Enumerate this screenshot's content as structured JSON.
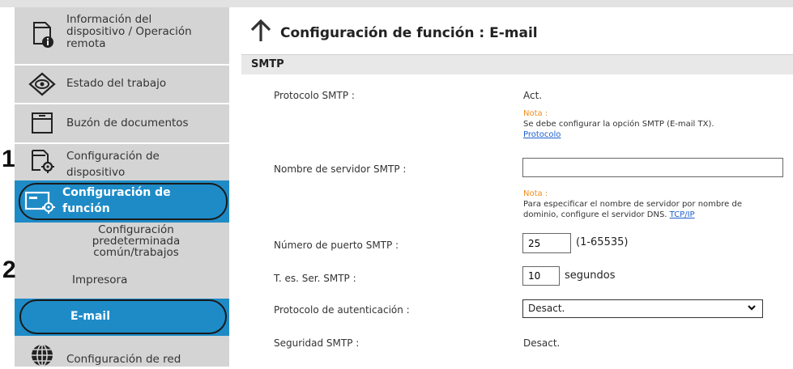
{
  "sidebar": {
    "items": [
      {
        "label": "Información del dispositivo / Operación remota",
        "icon": "device-info-icon"
      },
      {
        "label": "Estado del trabajo",
        "icon": "eye-icon"
      },
      {
        "label": "Buzón de documentos",
        "icon": "document-box-icon"
      },
      {
        "label": "Configuración de dispositivo",
        "icon": "device-settings-icon"
      },
      {
        "label": "Configuración de función",
        "icon": "function-settings-icon"
      },
      {
        "label": "Configuración predeterminada común/trabajos"
      },
      {
        "label": "Impresora"
      },
      {
        "label": "E-mail"
      },
      {
        "label": "Configuración de red",
        "icon": "globe-icon"
      }
    ]
  },
  "steps": {
    "one": "1",
    "two": "2"
  },
  "header": {
    "title": "Configuración de función : E-mail",
    "back_icon": "up-arrow-icon"
  },
  "section": {
    "title": "SMTP"
  },
  "fields": {
    "smtp_protocol": {
      "label": "Protocolo SMTP :",
      "value": "Act."
    },
    "note1": {
      "head": "Nota :",
      "text": "Se debe configurar la opción SMTP (E-mail TX).",
      "link": "Protocolo"
    },
    "server_name": {
      "label": "Nombre de servidor SMTP :",
      "value": ""
    },
    "note2": {
      "head": "Nota :",
      "text1": "Para especificar el nombre de servidor por nombre de",
      "text2": "dominio, configure el servidor DNS.",
      "link": "TCP/IP"
    },
    "port": {
      "label": "Número de puerto SMTP :",
      "value": "25",
      "hint": "(1-65535)"
    },
    "timeout": {
      "label": "T. es. Ser. SMTP :",
      "value": "10",
      "unit": "segundos"
    },
    "auth": {
      "label": "Protocolo de autenticación :",
      "selected": "Desact."
    },
    "security": {
      "label": "Seguridad SMTP :",
      "value": "Desact."
    }
  },
  "colors": {
    "accent": "#1e8bc7",
    "note": "#f08c1e",
    "link": "#1f5fd0",
    "sidebar": "#d4d4d4"
  }
}
